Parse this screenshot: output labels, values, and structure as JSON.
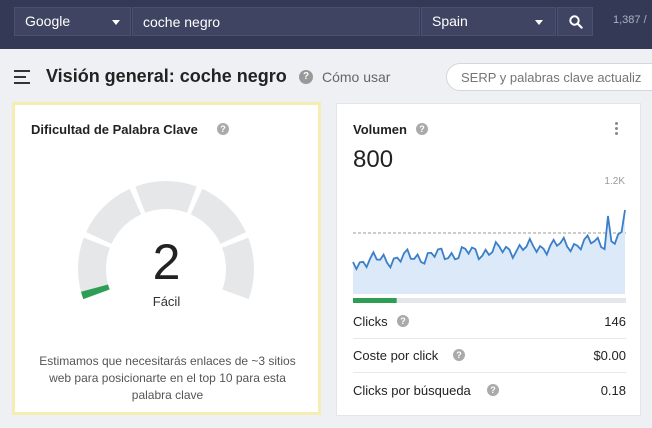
{
  "topbar": {
    "engine": "Google",
    "keyword": "coche negro",
    "country": "Spain",
    "credits": "1,387 /"
  },
  "header": {
    "title": "Visión general: coche negro",
    "howto": "Cómo usar",
    "serp_placeholder": "SERP y palabras clave actualiz"
  },
  "difficulty": {
    "title": "Dificultad de Palabra Clave",
    "score": "2",
    "score_value": 2,
    "label": "Fácil",
    "description": "Estimamos que necesitarás enlaces de ~3 sitios web para posicionarte en el top 10 para esta palabra clave",
    "accent": "#2e9e55"
  },
  "volume": {
    "title": "Volumen",
    "value": "800",
    "max_label": "1.2K",
    "clicks_share": 0.16,
    "series_color": "#3a7fc8",
    "rows": [
      {
        "label": "Clicks",
        "value": "146"
      },
      {
        "label": "Coste por click",
        "value": "$0.00"
      },
      {
        "label": "Clicks por búsqueda",
        "value": "0.18"
      }
    ]
  }
}
